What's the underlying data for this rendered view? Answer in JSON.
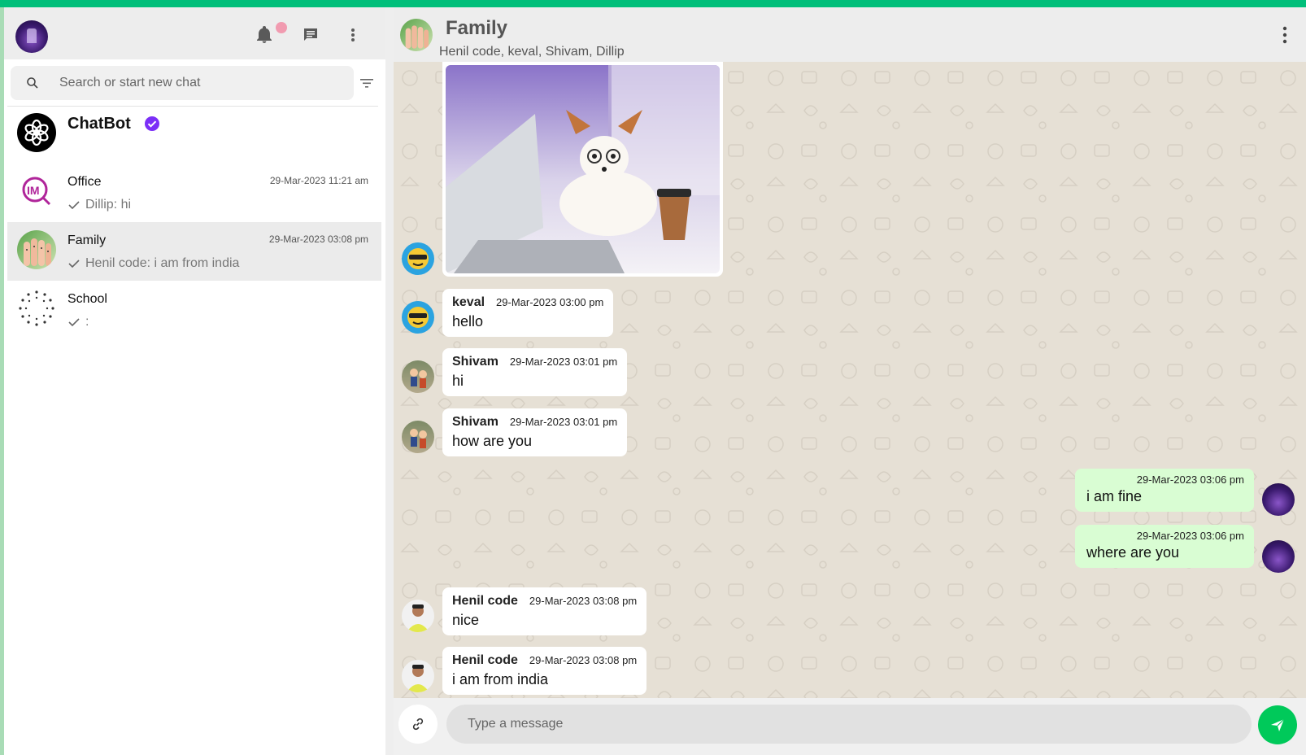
{
  "sidebar": {
    "search": {
      "placeholder": "Search or start new chat"
    },
    "chats": [
      {
        "name": "ChatBot",
        "verified": true,
        "time": "",
        "last": ""
      },
      {
        "name": "Office",
        "time": "29-Mar-2023 11:21 am",
        "last": "Dillip: hi"
      },
      {
        "name": "Family",
        "time": "29-Mar-2023 03:08 pm",
        "last": "Henil code: i am from india",
        "active": true
      },
      {
        "name": "School",
        "time": "",
        "last": ":"
      }
    ]
  },
  "conversation": {
    "title": "Family",
    "members": "Henil code, keval, Shivam, Dillip",
    "messages": [
      {
        "sender": "keval",
        "time": "29-Mar-2023 03:00 pm",
        "text": "hello"
      },
      {
        "sender": "Shivam",
        "time": "29-Mar-2023 03:01 pm",
        "text": "hi"
      },
      {
        "sender": "Shivam",
        "time": "29-Mar-2023 03:01 pm",
        "text": "how are you"
      },
      {
        "sender": "",
        "time": "29-Mar-2023 03:06 pm",
        "text": "i am fine",
        "outgoing": true
      },
      {
        "sender": "",
        "time": "29-Mar-2023 03:06 pm",
        "text": "where are you",
        "outgoing": true
      },
      {
        "sender": "Henil code",
        "time": "29-Mar-2023 03:08 pm",
        "text": "nice"
      },
      {
        "sender": "Henil code",
        "time": "29-Mar-2023 03:08 pm",
        "text": "i am from india"
      }
    ]
  },
  "composer": {
    "placeholder": "Type a message"
  },
  "colors": {
    "accent": "#00bf7a",
    "outgoing_bubble": "#d9fdd3",
    "send": "#00c95a",
    "verified": "#7b2ff7",
    "notif_dot": "#f19bb0"
  },
  "icons": [
    "bell-icon",
    "chat-icon",
    "menu-dots-icon",
    "search-icon",
    "filter-icon",
    "check-icon",
    "verified-badge-icon",
    "attach-link-icon",
    "send-icon"
  ]
}
